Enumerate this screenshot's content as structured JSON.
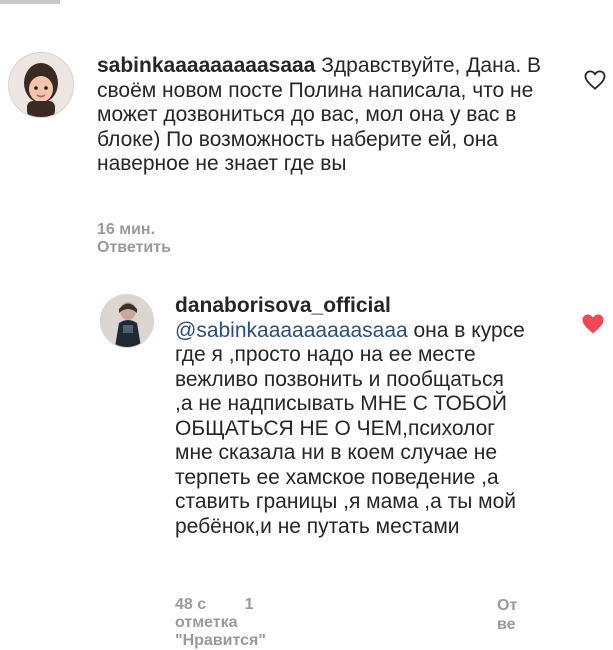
{
  "comments": [
    {
      "username": "sabinkaaaaaaaaasaaa",
      "text": "Здравствуйте, Дана. В своём новом посте Полина написала, что не может дозвониться до вас, мол она у вас в блоке) По возможность наберите ей, она наверное не знает где вы",
      "time": "16 мин.",
      "reply_label": "Ответить",
      "liked": false,
      "avatar_icon": "memoji-avatar-icon"
    },
    {
      "username": "danaborisova_official",
      "mention": "@sabinkaaaaaaaaasaaa",
      "text": " она в курсе где я ,просто надо на ее месте вежливо позвонить и пообщаться ,а не надписывать МНЕ С ТОБОЙ ОБЩАТЬСЯ НЕ О ЧЕМ,психолог мне сказала ни в коем случае не терпеть ее хамское поведение ,а ставить границы ,я мама ,а ты мой ребёнок,и не путать местами",
      "time": "48 с",
      "likes_label": "1 отметка \"Нравится\"",
      "reply_label": "От\nве",
      "liked": true,
      "avatar_icon": "profile-photo-avatar-icon"
    }
  ],
  "colors": {
    "heart_liked": "#ed4956",
    "heart_outline": "#262626",
    "mention": "#2b4d80",
    "meta": "#9a9a9a"
  }
}
